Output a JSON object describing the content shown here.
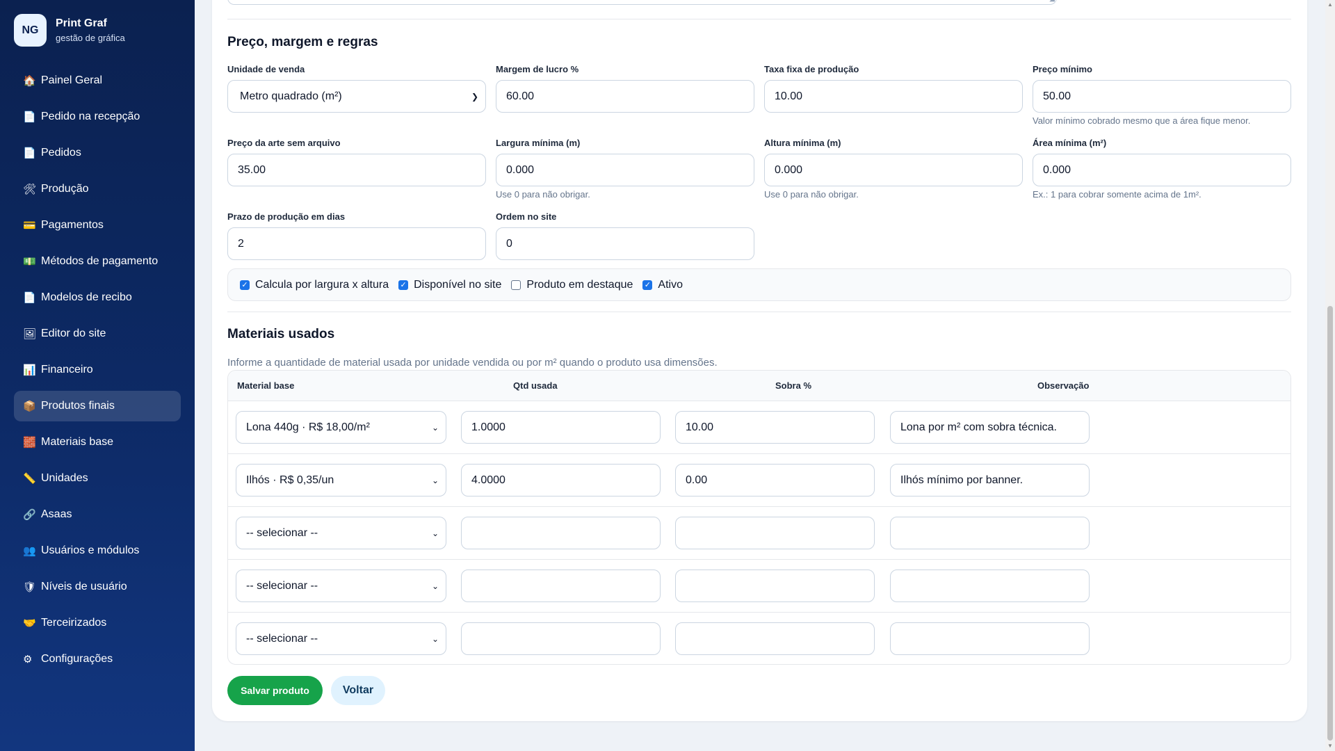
{
  "brand": {
    "initials": "NG",
    "name": "Print Graf",
    "subtitle": "gestão de gráfica"
  },
  "sidebar": {
    "items": [
      {
        "label": "Painel Geral",
        "icon": "🏠",
        "icon_name": "home-icon"
      },
      {
        "label": "Pedido na recepção",
        "icon": "📄",
        "icon_name": "document-icon"
      },
      {
        "label": "Pedidos",
        "icon": "📄",
        "icon_name": "document-icon"
      },
      {
        "label": "Produção",
        "icon": "🛠",
        "icon_name": "tools-icon"
      },
      {
        "label": "Pagamentos",
        "icon": "💳",
        "icon_name": "credit-card-icon"
      },
      {
        "label": "Métodos de pagamento",
        "icon": "💵",
        "icon_name": "money-icon"
      },
      {
        "label": "Modelos de recibo",
        "icon": "📄",
        "icon_name": "receipt-icon"
      },
      {
        "label": "Editor do site",
        "icon": "🖼",
        "icon_name": "picture-icon"
      },
      {
        "label": "Financeiro",
        "icon": "📊",
        "icon_name": "bar-chart-icon"
      },
      {
        "label": "Produtos finais",
        "icon": "📦",
        "icon_name": "box-icon",
        "active": true
      },
      {
        "label": "Materiais base",
        "icon": "🧱",
        "icon_name": "bricks-icon"
      },
      {
        "label": "Unidades",
        "icon": "📏",
        "icon_name": "ruler-icon"
      },
      {
        "label": "Asaas",
        "icon": "🔗",
        "icon_name": "link-icon"
      },
      {
        "label": "Usuários e módulos",
        "icon": "👥",
        "icon_name": "users-icon"
      },
      {
        "label": "Níveis de usuário",
        "icon": "🛡",
        "icon_name": "shield-icon"
      },
      {
        "label": "Terceirizados",
        "icon": "🤝",
        "icon_name": "handshake-icon"
      },
      {
        "label": "Configurações",
        "icon": "⚙",
        "icon_name": "gear-icon"
      }
    ]
  },
  "pricing": {
    "title": "Preço, margem e regras",
    "unit_label": "Unidade de venda",
    "unit_value": "Metro quadrado (m²)",
    "margin_label": "Margem de lucro %",
    "margin_value": "60.00",
    "fixed_fee_label": "Taxa fixa de produção",
    "fixed_fee_value": "10.00",
    "min_price_label": "Preço mínimo",
    "min_price_value": "50.00",
    "min_price_hint": "Valor mínimo cobrado mesmo que a área fique menor.",
    "art_price_label": "Preço da arte sem arquivo",
    "art_price_value": "35.00",
    "min_width_label": "Largura mínima (m)",
    "min_width_value": "0.000",
    "min_width_hint": "Use 0 para não obrigar.",
    "min_height_label": "Altura mínima (m)",
    "min_height_value": "0.000",
    "min_height_hint": "Use 0 para não obrigar.",
    "min_area_label": "Área mínima (m²)",
    "min_area_value": "0.000",
    "min_area_hint": "Ex.: 1 para cobrar somente acima de 1m².",
    "lead_time_label": "Prazo de produção em dias",
    "lead_time_value": "2",
    "site_order_label": "Ordem no site",
    "site_order_value": "0",
    "checkboxes": [
      {
        "label": "Calcula por largura x altura",
        "checked": true
      },
      {
        "label": "Disponível no site",
        "checked": true
      },
      {
        "label": "Produto em destaque",
        "checked": false
      },
      {
        "label": "Ativo",
        "checked": true
      }
    ]
  },
  "materials": {
    "title": "Materiais usados",
    "description": "Informe a quantidade de material usada por unidade vendida ou por m² quando o produto usa dimensões.",
    "headers": {
      "material": "Material base",
      "qty": "Qtd usada",
      "waste": "Sobra %",
      "note": "Observação"
    },
    "rows": [
      {
        "material": "Lona 440g · R$ 18,00/m²",
        "qty": "1.0000",
        "waste": "10.00",
        "note": "Lona por m² com sobra técnica."
      },
      {
        "material": "Ilhós · R$ 0,35/un",
        "qty": "4.0000",
        "waste": "0.00",
        "note": "Ilhós mínimo por banner."
      },
      {
        "material": "-- selecionar --",
        "qty": "",
        "waste": "",
        "note": ""
      },
      {
        "material": "-- selecionar --",
        "qty": "",
        "waste": "",
        "note": ""
      },
      {
        "material": "-- selecionar --",
        "qty": "",
        "waste": "",
        "note": ""
      }
    ]
  },
  "actions": {
    "save_label": "Salvar produto",
    "back_label": "Voltar"
  }
}
